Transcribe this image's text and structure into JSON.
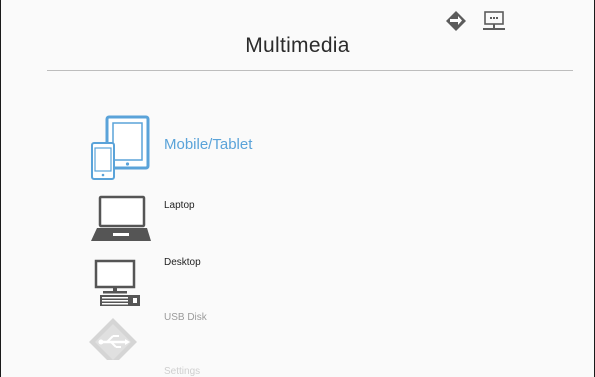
{
  "header": {
    "title": "Multimedia",
    "status_icons": [
      "network-diamond-icon",
      "lan-connection-icon"
    ]
  },
  "menu": {
    "items": [
      {
        "label": "Mobile/Tablet",
        "icon": "mobile-tablet-icon",
        "state": "selected"
      },
      {
        "label": "Laptop",
        "icon": "laptop-icon",
        "state": "normal"
      },
      {
        "label": "Desktop",
        "icon": "desktop-icon",
        "state": "normal"
      },
      {
        "label": "USB Disk",
        "icon": "usb-icon",
        "state": "faded"
      },
      {
        "label": "Settings",
        "icon": "settings-icon",
        "state": "faded"
      }
    ]
  },
  "colors": {
    "accent": "#5aa3d9",
    "text": "#222222",
    "icon_dark": "#555555",
    "faded": "#9a9a9a",
    "rule": "#bdbdbd"
  }
}
